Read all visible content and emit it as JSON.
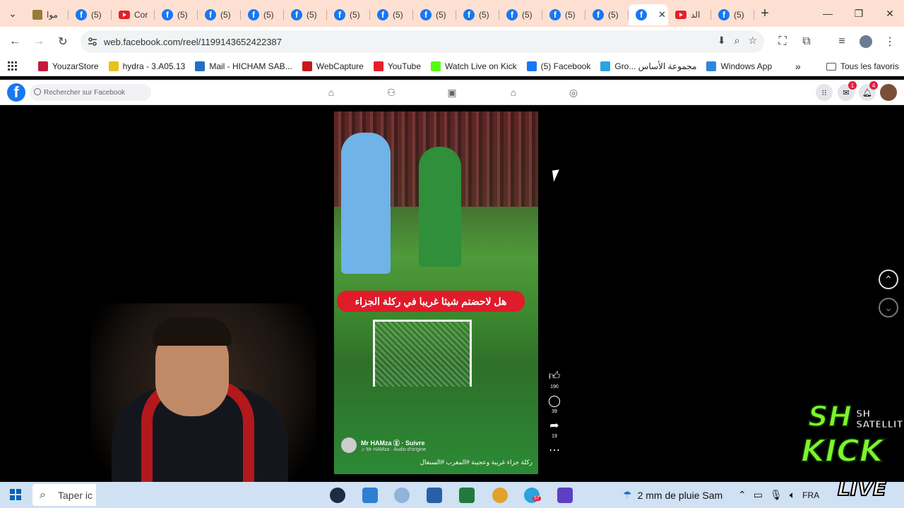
{
  "browser": {
    "tabs": [
      {
        "icon": "site-icon",
        "label": "موا"
      },
      {
        "icon": "facebook-icon",
        "label": "(5)"
      },
      {
        "icon": "youtube-icon",
        "label": "Cor"
      },
      {
        "icon": "facebook-icon",
        "label": "(5)"
      },
      {
        "icon": "facebook-icon",
        "label": "(5)"
      },
      {
        "icon": "facebook-icon",
        "label": "(5)"
      },
      {
        "icon": "facebook-icon",
        "label": "(5)"
      },
      {
        "icon": "facebook-icon",
        "label": "(5)"
      },
      {
        "icon": "facebook-icon",
        "label": "(5)"
      },
      {
        "icon": "facebook-icon",
        "label": "(5)"
      },
      {
        "icon": "facebook-icon",
        "label": "(5)"
      },
      {
        "icon": "facebook-icon",
        "label": "(5)"
      },
      {
        "icon": "facebook-icon",
        "label": "(5)"
      },
      {
        "icon": "facebook-icon",
        "label": "(5)"
      },
      {
        "icon": "facebook-icon",
        "label": "",
        "active": true
      },
      {
        "icon": "youtube-icon",
        "label": "الد"
      },
      {
        "icon": "facebook-icon",
        "label": "(5)"
      }
    ],
    "url": "web.facebook.com/reel/1199143652422387",
    "bookmarks": [
      {
        "label": "YouzarStore",
        "color": "#c4183a"
      },
      {
        "label": "hydra - 3.A05.13",
        "color": "#e7c21b"
      },
      {
        "label": "Mail - HICHAM SAB...",
        "color": "#1f6fc4"
      },
      {
        "label": "WebCapture",
        "color": "#c4181b"
      },
      {
        "label": "YouTube",
        "color": "#e5202a"
      },
      {
        "label": "Watch Live on Kick",
        "color": "#53fc18"
      },
      {
        "label": "(5) Facebook",
        "color": "#1877f2"
      },
      {
        "label": "Gro... مجموعة الأساس",
        "color": "#2aa3e0"
      },
      {
        "label": "Windows App",
        "color": "#2d86e0"
      }
    ],
    "bookmarks_overflow": "»",
    "all_bookmarks": "Tous les favoris"
  },
  "facebook": {
    "search_placeholder": "Rechercher sur Facebook",
    "messenger_badge": "1",
    "notifications_badge": "4"
  },
  "reel": {
    "caption": "هل لاحضتم شيئا غريبا في ركلة الجزاء",
    "author": "Mr HAMza ⓖ · Suivre",
    "audio": "♫ Mr HAMza · Audio d'origine",
    "description": "ركلة جزاء غريبة وعجيبة #المغرب #السنغال",
    "likes": "190",
    "comments": "39",
    "shares": "19"
  },
  "taskbar": {
    "search_text": "Taper ic",
    "weather": "2 mm de pluie Sam",
    "lang": "FRA",
    "telegram_badge": "57"
  },
  "overlay": {
    "sh": "SH",
    "satellite": "SH SATELLITE",
    "kick": "KICK",
    "live": "LIVE"
  },
  "colors": {
    "tabstrip": "#fde0d2",
    "facebook_blue": "#1877f2",
    "caption_red": "#e01b2a",
    "kick_green": "#7df52a"
  }
}
